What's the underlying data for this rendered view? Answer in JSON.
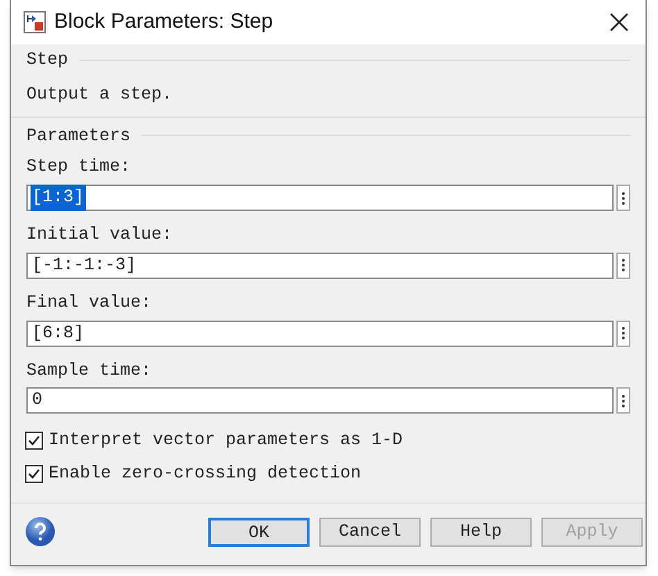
{
  "window": {
    "title": "Block Parameters: Step"
  },
  "description_group": {
    "title": "Step",
    "text": "Output a step."
  },
  "parameters_group": {
    "title": "Parameters",
    "fields": [
      {
        "label": "Step time:",
        "value": "[1:3]",
        "highlighted": true
      },
      {
        "label": "Initial value:",
        "value": "[-1:-1:-3]",
        "highlighted": false
      },
      {
        "label": "Final value:",
        "value": "[6:8]",
        "highlighted": false
      },
      {
        "label": "Sample time:",
        "value": "0",
        "highlighted": false
      }
    ],
    "checkboxes": [
      {
        "label": "Interpret vector parameters as 1-D",
        "checked": true
      },
      {
        "label": "Enable zero-crossing detection",
        "checked": true
      }
    ]
  },
  "buttons": [
    {
      "label": "OK",
      "default": true,
      "disabled": false
    },
    {
      "label": "Cancel",
      "default": false,
      "disabled": false
    },
    {
      "label": "Help",
      "default": false,
      "disabled": false
    },
    {
      "label": "Apply",
      "default": false,
      "disabled": true
    }
  ]
}
